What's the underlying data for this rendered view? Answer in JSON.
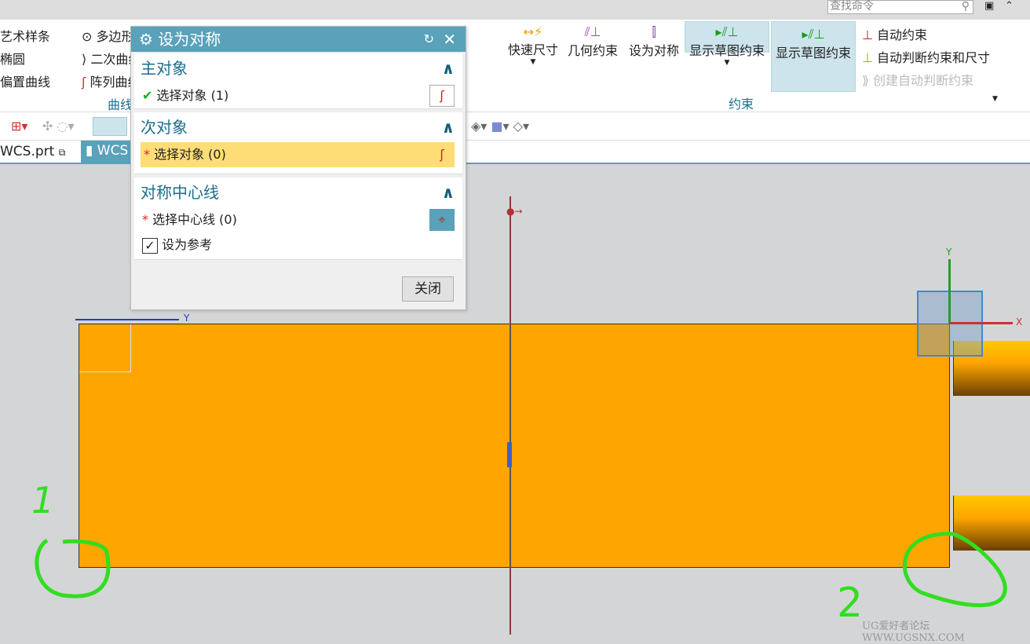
{
  "search": {
    "placeholder": "查找命令"
  },
  "ribbon": {
    "curve_items": [
      "艺术样条",
      "椭圆",
      "偏置曲线",
      "多边形",
      "二次曲线",
      "阵列曲线"
    ],
    "curve_group": "曲线",
    "buttons": [
      "快速尺寸",
      "几何约束",
      "设为对称",
      "显示草图约束",
      "显示草图约束"
    ],
    "right_items": [
      "自动约束",
      "自动判断约束和尺寸",
      "创建自动判断约束"
    ],
    "constraint_group": "约束"
  },
  "tabs": [
    "WCS.prt",
    "WCS"
  ],
  "dialog": {
    "title": "设为对称",
    "primary": {
      "header": "主对象",
      "select": "选择对象 (1)"
    },
    "secondary": {
      "header": "次对象",
      "select": "选择对象 (0)"
    },
    "centerline": {
      "header": "对称中心线",
      "select": "选择中心线 (0)",
      "checkbox": "设为参考",
      "checked": true
    },
    "close": "关闭"
  },
  "viewport": {
    "axis_x": "X",
    "axis_y": "Y",
    "axis_y2": "Y",
    "annotation_1": "1",
    "annotation_2": "2"
  },
  "watermark": "UG爱好者论坛 WWW.UGSNX.COM",
  "colors": {
    "accent": "#5aa1ba",
    "sheet": "#ffa500",
    "highlight": "#fedd77"
  }
}
